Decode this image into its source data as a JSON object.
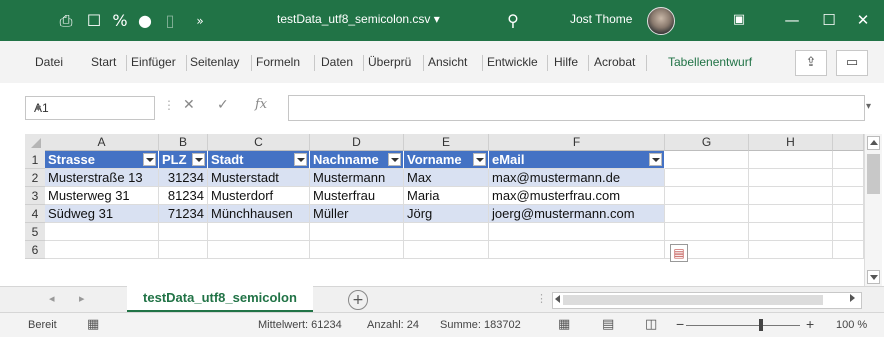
{
  "titlebar": {
    "file_title": "testData_utf8_semicolon.csv",
    "title_dropdown": "▾",
    "user_name": "Jost Thome",
    "bg_color": "#217346"
  },
  "ribbon": {
    "tabs": [
      "Datei",
      "Start",
      "Einfüger",
      "Seitenlay",
      "Formeln",
      "Daten",
      "Überprü",
      "Ansicht",
      "Entwickle",
      "Hilfe",
      "Acrobat"
    ],
    "context_tab": "Tabellenentwurf"
  },
  "formula_bar": {
    "name_box": "A1",
    "fx_label": "fx",
    "value": ""
  },
  "grid": {
    "columns": [
      "A",
      "B",
      "C",
      "D",
      "E",
      "F",
      "G",
      "H"
    ],
    "rows": [
      "1",
      "2",
      "3",
      "4",
      "5",
      "6"
    ],
    "header": [
      "Strasse",
      "PLZ",
      "Stadt",
      "Nachname",
      "Vorname",
      "eMail"
    ],
    "data": [
      [
        "Musterstraße 13",
        "31234",
        "Musterstadt",
        "Mustermann",
        "Max",
        "max@mustermann.de"
      ],
      [
        "Musterweg 31",
        "81234",
        "Musterdorf",
        "Musterfrau",
        "Maria",
        "max@musterfrau.com"
      ],
      [
        "Südweg 31",
        "71234",
        "Münchhausen",
        "Müller",
        "Jörg",
        "joerg@mustermann.com"
      ]
    ],
    "table_header_color": "#4472c4",
    "table_band_color": "#d9e1f2"
  },
  "sheets": {
    "active": "testData_utf8_semicolon",
    "add_symbol": "+"
  },
  "status": {
    "ready": "Bereit",
    "average": "Mittelwert: 61234",
    "count": "Anzahl: 24",
    "sum": "Summe: 183702",
    "zoom": "100 %",
    "zoom_minus": "−",
    "zoom_plus": "+"
  }
}
